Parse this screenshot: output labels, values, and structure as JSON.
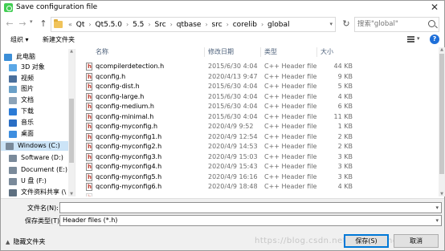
{
  "window": {
    "title": "Save configuration file",
    "close_glyph": "✕"
  },
  "address": {
    "crumbs": [
      "Qt",
      "Qt5.5.0",
      "5.5",
      "Src",
      "qtbase",
      "src",
      "corelib",
      "global"
    ],
    "overflow": "«"
  },
  "search": {
    "placeholder": "搜索\"global\""
  },
  "toolbar": {
    "organize": "组织 ▾",
    "new_folder": "新建文件夹"
  },
  "sidebar": {
    "items": [
      {
        "label": "此电脑",
        "icon": "pc-icon",
        "color": "#3c8fd8"
      },
      {
        "label": "3D 对象",
        "icon": "cube-icon",
        "color": "#5aa7e6"
      },
      {
        "label": "视频",
        "icon": "video-icon",
        "color": "#4a6f9c"
      },
      {
        "label": "图片",
        "icon": "pictures-icon",
        "color": "#6aa0c8"
      },
      {
        "label": "文档",
        "icon": "documents-icon",
        "color": "#8ca3b8"
      },
      {
        "label": "下载",
        "icon": "download-icon",
        "color": "#2b7bd6"
      },
      {
        "label": "音乐",
        "icon": "music-icon",
        "color": "#2a6ec4"
      },
      {
        "label": "桌面",
        "icon": "desktop-icon",
        "color": "#3d8ee0"
      },
      {
        "label": "Windows (C:)",
        "icon": "drive-icon",
        "color": "#7a8a9a"
      },
      {
        "label": "Software (D:)",
        "icon": "drive-icon",
        "color": "#7a8a9a"
      },
      {
        "label": "Document (E:)",
        "icon": "drive-icon",
        "color": "#7a8a9a"
      },
      {
        "label": "U 盘 (F:)",
        "icon": "drive-icon",
        "color": "#7a8a9a"
      },
      {
        "label": "文件资料共享 (\\",
        "icon": "network-drive-icon",
        "color": "#5d6f80"
      }
    ]
  },
  "filelist": {
    "headers": {
      "name": "名称",
      "date": "修改日期",
      "type": "类型",
      "size": "大小",
      "sort_glyph": "^"
    },
    "rows": [
      {
        "name": "qcompilerdetection.h",
        "date": "2015/6/30 4:04",
        "type": "C++ Header file",
        "size": "44 KB"
      },
      {
        "name": "qconfig.h",
        "date": "2020/4/13 9:47",
        "type": "C++ Header file",
        "size": "9 KB"
      },
      {
        "name": "qconfig-dist.h",
        "date": "2015/6/30 4:04",
        "type": "C++ Header file",
        "size": "5 KB"
      },
      {
        "name": "qconfig-large.h",
        "date": "2015/6/30 4:04",
        "type": "C++ Header file",
        "size": "4 KB"
      },
      {
        "name": "qconfig-medium.h",
        "date": "2015/6/30 4:04",
        "type": "C++ Header file",
        "size": "6 KB"
      },
      {
        "name": "qconfig-minimal.h",
        "date": "2015/6/30 4:04",
        "type": "C++ Header file",
        "size": "11 KB"
      },
      {
        "name": "qconfig-myconfig.h",
        "date": "2020/4/9 9:52",
        "type": "C++ Header file",
        "size": "1 KB"
      },
      {
        "name": "qconfig-myconfig1.h",
        "date": "2020/4/9 12:54",
        "type": "C++ Header file",
        "size": "2 KB"
      },
      {
        "name": "qconfig-myconfig2.h",
        "date": "2020/4/9 14:53",
        "type": "C++ Header file",
        "size": "2 KB"
      },
      {
        "name": "qconfig-myconfig3.h",
        "date": "2020/4/9 15:03",
        "type": "C++ Header file",
        "size": "3 KB"
      },
      {
        "name": "qconfig-myconfig4.h",
        "date": "2020/4/9 15:43",
        "type": "C++ Header file",
        "size": "3 KB"
      },
      {
        "name": "qconfig-myconfig5.h",
        "date": "2020/4/9 16:16",
        "type": "C++ Header file",
        "size": "3 KB"
      },
      {
        "name": "qconfig-myconfig6.h",
        "date": "2020/4/9 18:48",
        "type": "C++ Header file",
        "size": "4 KB"
      }
    ]
  },
  "form": {
    "filename_label": "文件名(N):",
    "filename_value": "",
    "filetype_label": "保存类型(T):",
    "filetype_value": "Header files (*.h)"
  },
  "footer": {
    "hide_folders": "隐藏文件夹",
    "save": "保存(S)",
    "cancel": "取消",
    "watermark": "https://blog.csdn.net/wu_zhiqing"
  }
}
